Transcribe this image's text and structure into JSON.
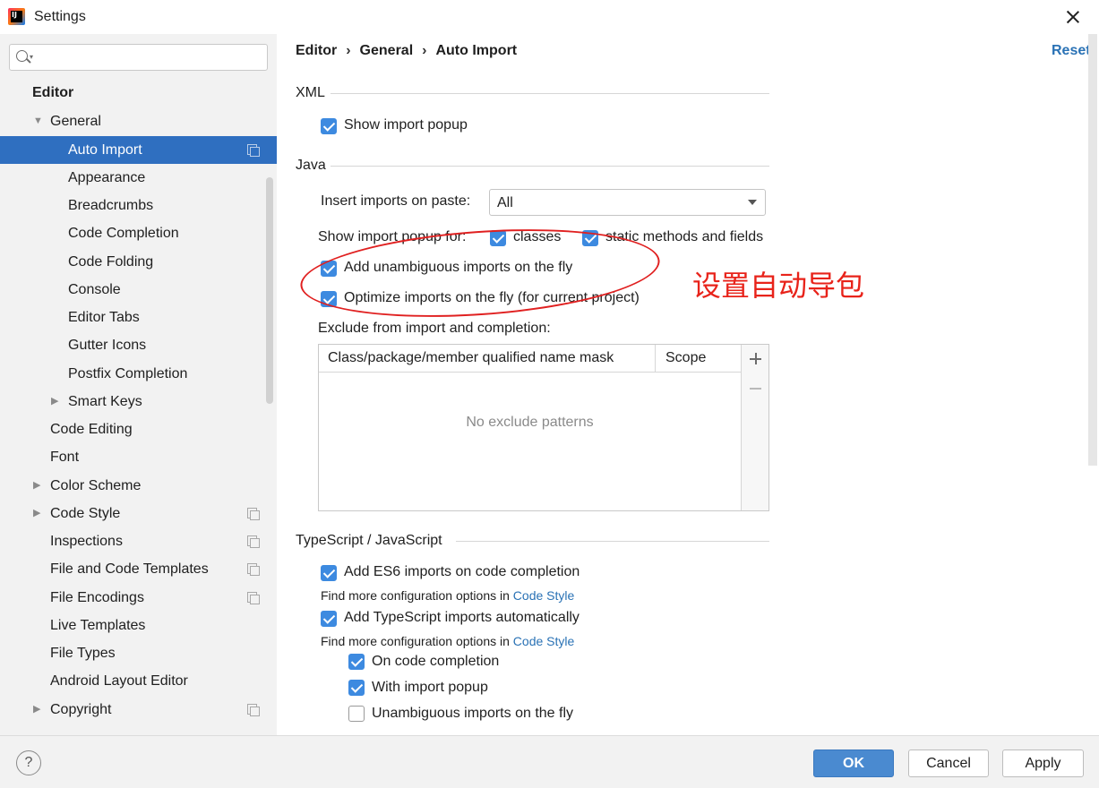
{
  "window": {
    "title": "Settings",
    "app_icon_text": "IJ"
  },
  "search": {
    "placeholder": ""
  },
  "sidebar": {
    "items": [
      {
        "label": "Editor"
      },
      {
        "label": "General"
      },
      {
        "label": "Auto Import"
      },
      {
        "label": "Appearance"
      },
      {
        "label": "Breadcrumbs"
      },
      {
        "label": "Code Completion"
      },
      {
        "label": "Code Folding"
      },
      {
        "label": "Console"
      },
      {
        "label": "Editor Tabs"
      },
      {
        "label": "Gutter Icons"
      },
      {
        "label": "Postfix Completion"
      },
      {
        "label": "Smart Keys"
      },
      {
        "label": "Code Editing"
      },
      {
        "label": "Font"
      },
      {
        "label": "Color Scheme"
      },
      {
        "label": "Code Style"
      },
      {
        "label": "Inspections"
      },
      {
        "label": "File and Code Templates"
      },
      {
        "label": "File Encodings"
      },
      {
        "label": "Live Templates"
      },
      {
        "label": "File Types"
      },
      {
        "label": "Android Layout Editor"
      },
      {
        "label": "Copyright"
      }
    ]
  },
  "breadcrumb": {
    "items": [
      "Editor",
      "General",
      "Auto Import"
    ],
    "separator": "›"
  },
  "reset_label": "Reset",
  "xml": {
    "title": "XML",
    "show_import_popup": "Show import popup"
  },
  "java": {
    "title": "Java",
    "insert_imports_label": "Insert imports on paste:",
    "insert_imports_value": "All",
    "show_popup_for_label": "Show import popup for:",
    "classes_label": "classes",
    "static_label": "static methods and fields",
    "add_unambiguous_label": "Add unambiguous imports on the fly",
    "optimize_label": "Optimize imports on the fly (for current project)",
    "exclude_label": "Exclude from import and completion:",
    "table": {
      "columns": [
        "Class/package/member qualified name mask",
        "Scope"
      ],
      "empty_text": "No exclude patterns"
    }
  },
  "typescript": {
    "title": "TypeScript / JavaScript",
    "add_es6_label": "Add ES6 imports on code completion",
    "find_more_prefix": "Find more configuration options in",
    "code_style_link": "Code Style",
    "add_ts_label": "Add TypeScript imports automatically",
    "on_code_completion_label": "On code completion",
    "with_import_popup_label": "With import popup",
    "unambiguous_label": "Unambiguous imports on the fly"
  },
  "annotation": {
    "text": "设置自动导包",
    "color": "#e8231a"
  },
  "buttons": {
    "help": "?",
    "ok": "OK",
    "cancel": "Cancel",
    "apply": "Apply"
  },
  "colors": {
    "selection": "#2f6fc0",
    "accent": "#3d8ae0",
    "link": "#2a72b5"
  }
}
